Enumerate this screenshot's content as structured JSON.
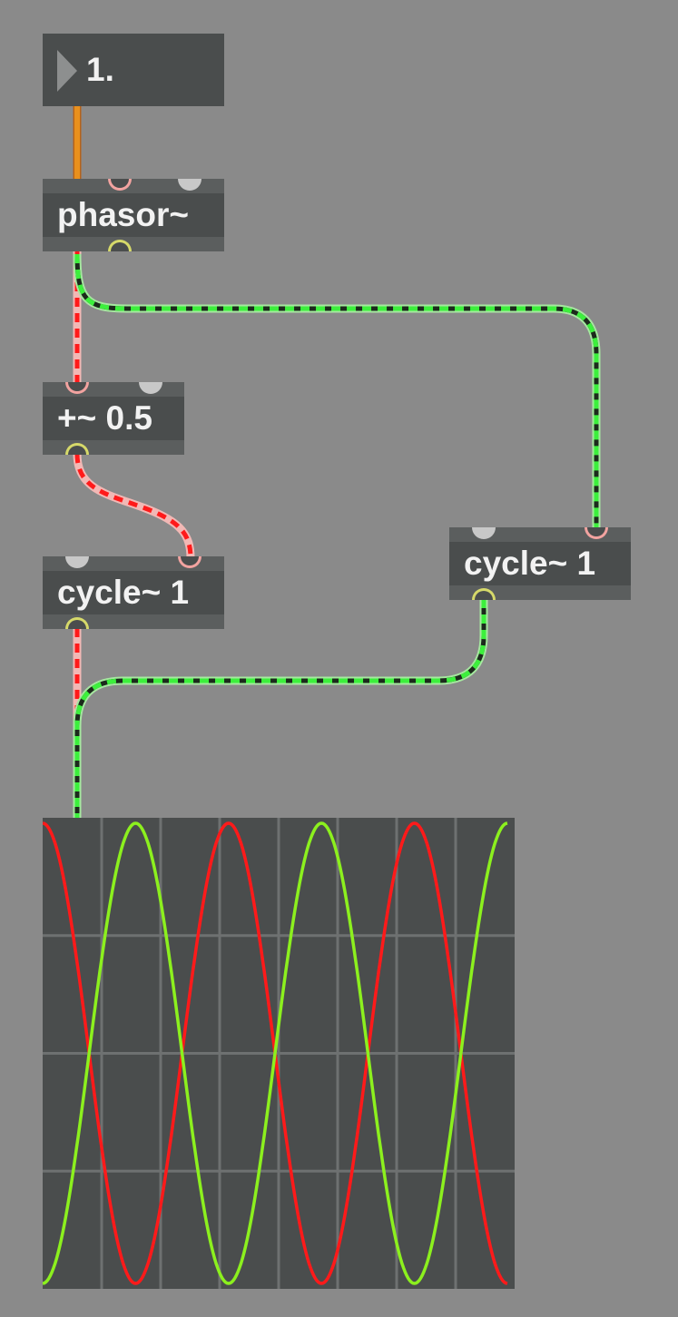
{
  "patcher": {
    "number_box": {
      "value": "1."
    },
    "objects": {
      "phasor": "phasor~",
      "plus": "+~ 0.5",
      "cycle_left": "cycle~ 1",
      "cycle_right": "cycle~ 1"
    }
  },
  "colors": {
    "background": "#8a8a8a",
    "object_fill": "#4a4d4d",
    "control_cord": "#e8901e",
    "signal_cord_red": "#ff1a1a",
    "signal_cord_green": "#3cf03c",
    "scope_trace_red": "#ff1a1a",
    "scope_trace_green": "#8cf01e",
    "scope_grid": "#6e7171"
  },
  "scope_data": {
    "type": "line",
    "samples": 8,
    "cycles_shown": 2.5,
    "series": [
      {
        "trace": "red",
        "phase_offset": 0.5,
        "amplitude": 1
      },
      {
        "trace": "green",
        "phase_offset": 0,
        "amplitude": 1
      }
    ],
    "ylim": [
      -1,
      1
    ],
    "grid": true
  }
}
